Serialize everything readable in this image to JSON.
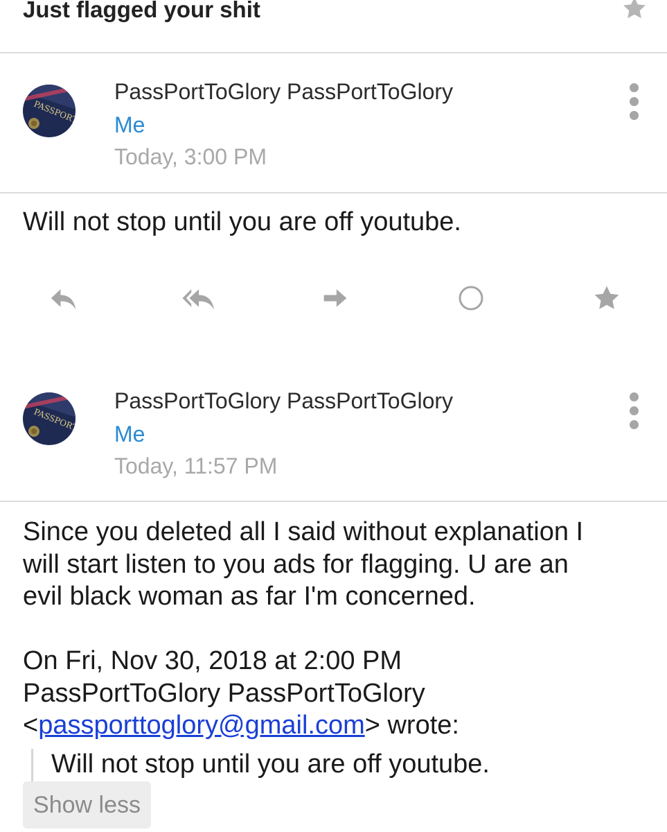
{
  "subject": "Just flagged your shit",
  "messages": [
    {
      "sender": "PassPortToGlory PassPortToGlory",
      "recipient": "Me",
      "timestamp": "Today, 3:00 PM",
      "body": "Will not stop until you are off youtube."
    },
    {
      "sender": "PassPortToGlory PassPortToGlory",
      "recipient": "Me",
      "timestamp": "Today, 11:57 PM",
      "body_lines": [
        "Since you deleted all I said without explanation I",
        "will start listen to you ads for flagging. U are an",
        "evil black woman as far I'm concerned."
      ],
      "quoted_header_line1": "On Fri, Nov 30, 2018 at 2:00 PM",
      "quoted_header_line2": "PassPortToGlory PassPortToGlory",
      "quoted_email_open": "<",
      "quoted_email": "passporttoglory@gmail.com",
      "quoted_email_close": "> wrote:",
      "quoted_text": "Will not stop until you are off youtube."
    }
  ],
  "show_less_label": "Show less",
  "icons": {
    "star": "star-icon",
    "more": "more-vert-icon",
    "reply": "reply-icon",
    "reply_all": "reply-all-icon",
    "forward": "forward-icon",
    "mark": "circle-icon"
  },
  "colors": {
    "recipient": "#2a8ad4",
    "timestamp": "#a8a8a8",
    "icon_gray": "#a6a6a6",
    "link": "#1a3fd6",
    "divider": "#dcdcdc"
  }
}
